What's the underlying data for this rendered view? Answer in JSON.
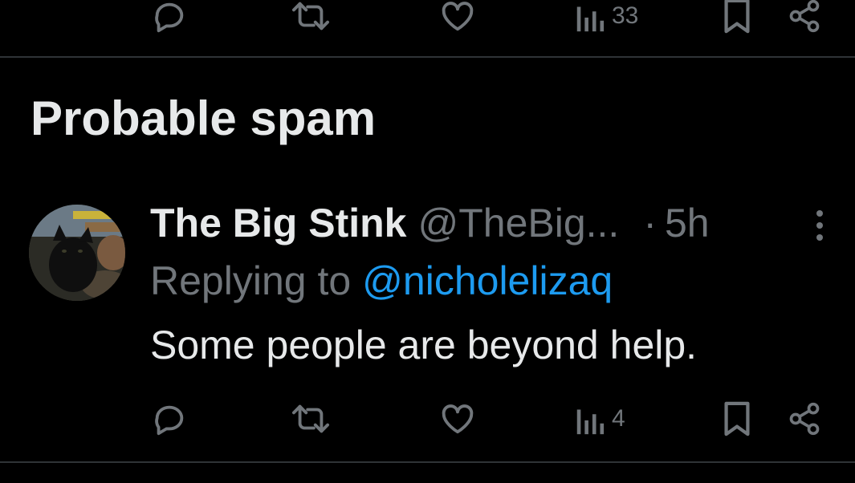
{
  "top_actions": {
    "views_count": "33"
  },
  "section": {
    "heading": "Probable spam"
  },
  "tweet": {
    "display_name": "The Big Stink",
    "handle": "@TheBig...",
    "separator": "·",
    "time": "5h",
    "reply_prefix": "Replying to",
    "reply_mention": "@nicholelizaq",
    "text": "Some people are beyond help.",
    "actions": {
      "views_count": "4"
    }
  },
  "icons": {
    "reply": "reply-icon",
    "retweet": "retweet-icon",
    "like": "like-icon",
    "views": "views-icon",
    "bookmark": "bookmark-icon",
    "share": "share-icon",
    "more": "more-icon"
  },
  "colors": {
    "background": "#000000",
    "primary_text": "#e7e9ea",
    "secondary_text": "#71767b",
    "accent": "#1d9bf0",
    "divider": "#2f3336"
  }
}
